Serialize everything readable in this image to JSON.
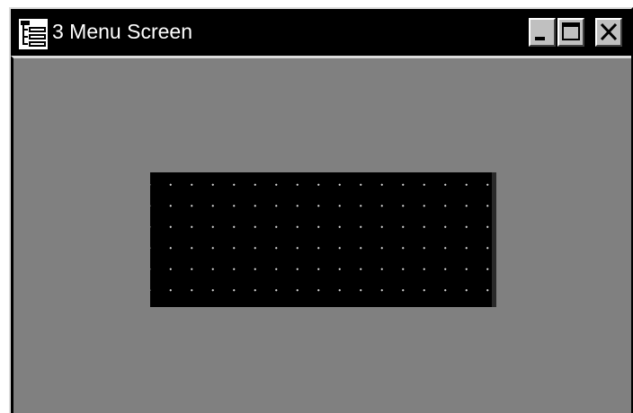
{
  "window": {
    "title": "3 Menu Screen",
    "icons": {
      "app": "menu-tree-icon",
      "minimize": "minimize-icon",
      "maximize": "maximize-icon",
      "close": "close-icon"
    },
    "colors": {
      "titlebar": "#000000",
      "title_text": "#ffffff",
      "client_background": "#808080",
      "canvas_background": "#000000",
      "grid_dots": "#d8d8d8"
    }
  }
}
